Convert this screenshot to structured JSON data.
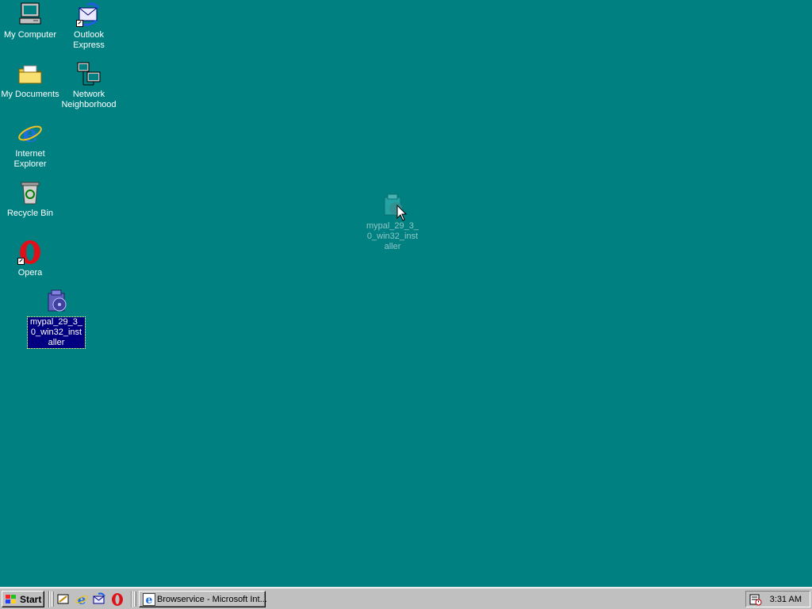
{
  "desktop": {
    "background_color": "#008080",
    "icons": [
      {
        "label": "My Computer",
        "icon": "my-computer-icon"
      },
      {
        "label": "Outlook Express",
        "icon": "outlook-express-icon"
      },
      {
        "label": "My Documents",
        "icon": "my-documents-icon"
      },
      {
        "label": "Network Neighborhood",
        "icon": "network-neighborhood-icon"
      },
      {
        "label": "Internet Explorer",
        "icon": "internet-explorer-icon"
      },
      {
        "label": "Recycle Bin",
        "icon": "recycle-bin-icon"
      },
      {
        "label": "Opera",
        "icon": "opera-icon"
      },
      {
        "label": "mypal_29_3_0_win32_installer",
        "icon": "installer-icon",
        "selected": true
      },
      {
        "label": "mypal_29_3_0_win32_installer",
        "icon": "installer-icon",
        "dragging": true
      }
    ]
  },
  "taskbar": {
    "start_label": "Start",
    "quick_launch": [
      "show-desktop-icon",
      "internet-explorer-icon",
      "outlook-express-icon",
      "opera-icon"
    ],
    "tasks": [
      {
        "label": "Browservice - Microsoft Int...",
        "icon": "internet-explorer-icon"
      }
    ],
    "tray": {
      "icons": [
        "scheduler-icon"
      ],
      "clock": "3:31 AM"
    }
  }
}
